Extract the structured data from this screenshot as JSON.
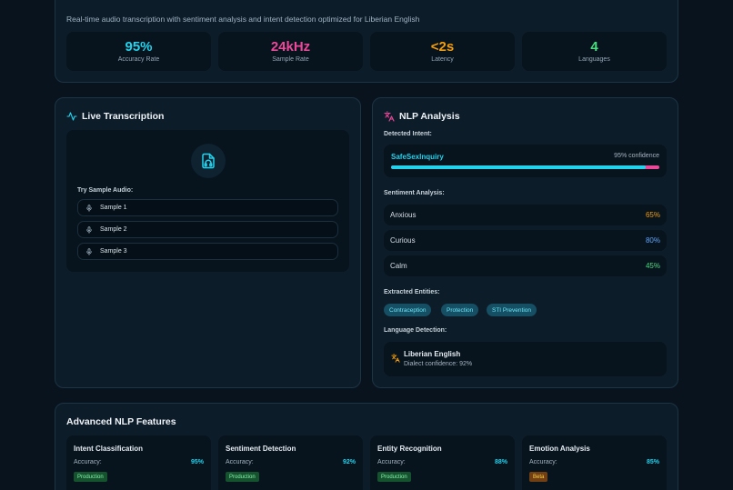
{
  "header": {
    "subtitle": "Real-time audio transcription with sentiment analysis and intent detection optimized for Liberian English"
  },
  "stats": [
    {
      "value": "95%",
      "label": "Accuracy Rate",
      "color": "#22d3ee"
    },
    {
      "value": "24kHz",
      "label": "Sample Rate",
      "color": "#ec4899"
    },
    {
      "value": "<2s",
      "label": "Latency",
      "color": "#f59e0b"
    },
    {
      "value": "4",
      "label": "Languages",
      "color": "#4ade80"
    }
  ],
  "transcription": {
    "title": "Live Transcription",
    "icon": "activity-icon",
    "audio_icon": "file-audio-icon",
    "try_label": "Try Sample Audio:",
    "samples": [
      "Sample 1",
      "Sample 2",
      "Sample 3"
    ]
  },
  "nlp": {
    "title": "NLP Analysis",
    "icon": "languages-icon",
    "intent_label": "Detected Intent:",
    "intent": {
      "name": "SafeSexInquiry",
      "confidence_text": "95% confidence",
      "confidence": 0.95
    },
    "sentiment_label": "Sentiment Analysis:",
    "sentiments": [
      {
        "name": "Anxious",
        "value": "65%",
        "color": "#f59e0b"
      },
      {
        "name": "Curious",
        "value": "80%",
        "color": "#60a5fa"
      },
      {
        "name": "Calm",
        "value": "45%",
        "color": "#4ade80"
      }
    ],
    "entities_label": "Extracted Entities:",
    "entities": [
      "Contraception",
      "Protection",
      "STI Prevention"
    ],
    "language_label": "Language Detection:",
    "language": {
      "name": "Liberian English",
      "dialect": "Dialect confidence: 92%"
    }
  },
  "features": {
    "title": "Advanced NLP Features",
    "items": [
      {
        "title": "Intent Classification",
        "accuracy_label": "Accuracy:",
        "accuracy": "95%",
        "badge": "Production"
      },
      {
        "title": "Sentiment Detection",
        "accuracy_label": "Accuracy:",
        "accuracy": "92%",
        "badge": "Production"
      },
      {
        "title": "Entity Recognition",
        "accuracy_label": "Accuracy:",
        "accuracy": "88%",
        "badge": "Production"
      },
      {
        "title": "Emotion Analysis",
        "accuracy_label": "Accuracy:",
        "accuracy": "85%",
        "badge": "Beta"
      }
    ]
  }
}
